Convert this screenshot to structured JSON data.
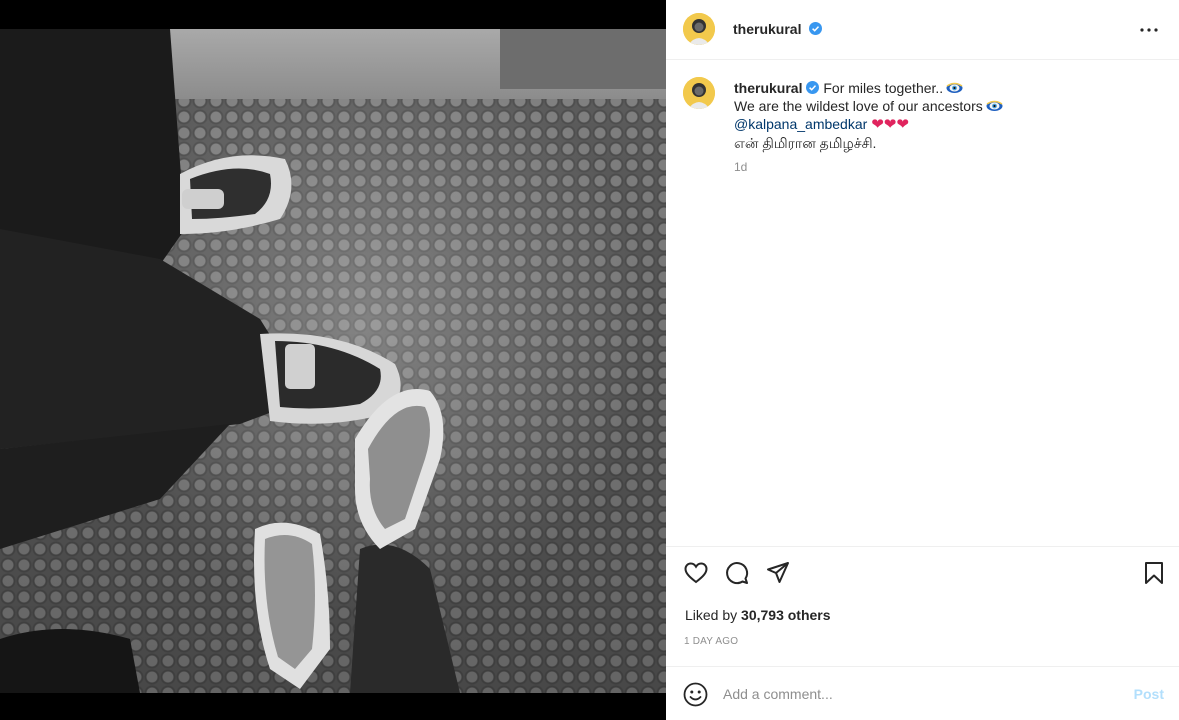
{
  "post": {
    "username": "therukural",
    "caption_line1": "For miles together..",
    "caption_line2": "We are the wildest love of our ancestors",
    "mention": "@kalpana_ambedkar",
    "hearts": "❤❤❤",
    "caption_line4": "என் திமிரான தமிழச்சி.",
    "relative_time": "1d",
    "likes_prefix": "Liked by",
    "likes_count": "30,793 others",
    "date_label": "1 DAY AGO"
  },
  "comment": {
    "placeholder": "Add a comment...",
    "post_label": "Post"
  },
  "icons": {
    "more": "more-horizontal-icon",
    "like": "heart-icon",
    "comment": "comment-icon",
    "share": "paper-plane-icon",
    "save": "bookmark-icon",
    "emoji": "smiley-icon",
    "verified": "verified-badge-icon"
  },
  "colors": {
    "verified": "#3897f0",
    "mention": "#00376b",
    "post_button": "#b2dffc",
    "muted": "#8e8e8e"
  }
}
